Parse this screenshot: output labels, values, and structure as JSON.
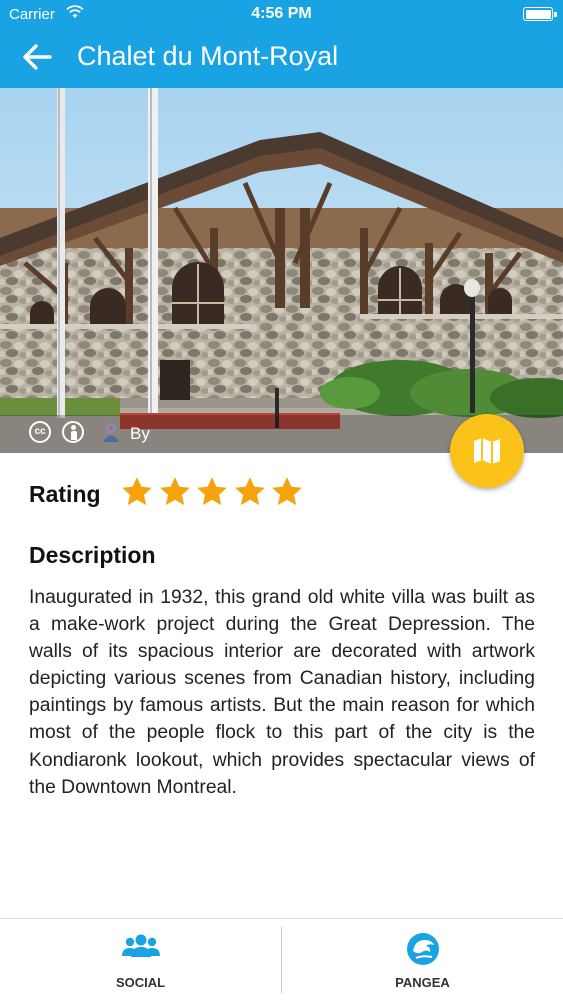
{
  "status_bar": {
    "carrier": "Carrier",
    "time": "4:56 PM"
  },
  "nav": {
    "title": "Chalet du Mont-Royal",
    "back_icon": "arrow-left-icon"
  },
  "hero": {
    "attribution_text": "By",
    "license_icons": [
      "creative-commons-icon",
      "attribution-icon",
      "author-icon"
    ]
  },
  "map_button": {
    "icon": "map-icon",
    "color": "#fbc21a"
  },
  "rating": {
    "label": "Rating",
    "stars": 5,
    "max": 5,
    "star_color": "#f5a20d"
  },
  "description": {
    "heading": "Description",
    "text": "Inaugurated in 1932, this grand old white villa was built as a make-work project during the Great Depression. The walls of its spacious interior are decorated with artwork depicting various scenes from Canadian history, including paintings by famous artists. But the main reason for which most of the people flock to this part of the city is the Kondiaronk lookout, which provides spectacular views of the Downtown Montreal."
  },
  "tabs": [
    {
      "label": "SOCIAL",
      "icon": "people-icon"
    },
    {
      "label": "PANGEA",
      "icon": "pangea-logo-icon"
    }
  ],
  "colors": {
    "header": "#1aa3e3",
    "tab_icon": "#1aa3e3"
  }
}
